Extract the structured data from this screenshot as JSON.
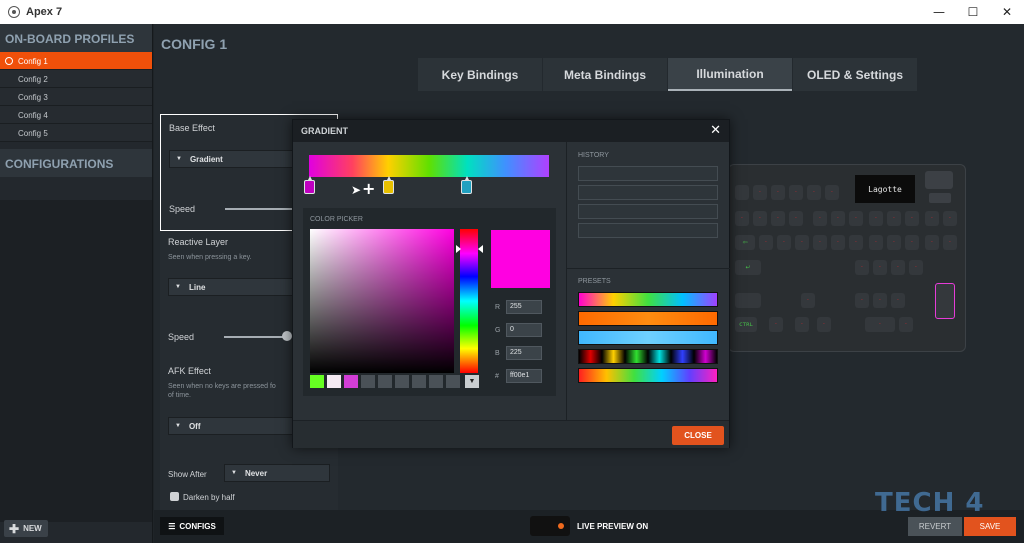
{
  "window": {
    "title": "Apex 7",
    "minimize": "—",
    "maximize": "☐",
    "close": "✕"
  },
  "sidebar": {
    "profiles_header": "ON-BOARD PROFILES",
    "profiles": [
      "Config 1",
      "Config 2",
      "Config 3",
      "Config 4",
      "Config 5"
    ],
    "configurations_header": "CONFIGURATIONS",
    "new_label": "NEW"
  },
  "main": {
    "config_title": "CONFIG 1",
    "tabs": [
      "Key Bindings",
      "Meta Bindings",
      "Illumination",
      "OLED & Settings"
    ],
    "active_tab": "Illumination"
  },
  "settings": {
    "base_effect_label": "Base Effect",
    "base_effect_value": "Gradient",
    "speed_label": "Speed",
    "reactive_label": "Reactive Layer",
    "reactive_desc": "Seen when pressing a key.",
    "reactive_value": "Line",
    "speed2_label": "Speed",
    "afk_label": "AFK Effect",
    "afk_desc_1": "Seen when no keys are pressed fo",
    "afk_desc_2": "of time.",
    "afk_value": "Off",
    "show_after_label": "Show After",
    "show_after_value": "Never",
    "darken_label": "Darken by half"
  },
  "keyboard": {
    "oled_text": "Lagotte"
  },
  "dialog": {
    "title": "GRADIENT",
    "close_icon": "✕",
    "picker_label": "COLOR PICKER",
    "r_label": "R",
    "r_value": "255",
    "g_label": "G",
    "g_value": "0",
    "b_label": "B",
    "b_value": "225",
    "hex_label": "#",
    "hex_value": "ff00e1",
    "history_label": "HISTORY",
    "presets_label": "PRESETS",
    "close_label": "CLOSE",
    "selected_color": "#ff00e1",
    "gradient_stops": [
      "#c000c0",
      "#e8c000",
      "#20a0c0"
    ],
    "swatches": [
      "#66ff22",
      "#f4eaf2",
      "#d23ed6",
      "#4a5157",
      "#4a5157",
      "#4a5157",
      "#4a5157",
      "#4a5157",
      "#4a5157",
      "#4a5157"
    ]
  },
  "bottom": {
    "configs_label": "CONFIGS",
    "live_preview_label": "LIVE PREVIEW ON",
    "revert_label": "REVERT",
    "save_label": "SAVE"
  },
  "watermark": "TECH 4"
}
